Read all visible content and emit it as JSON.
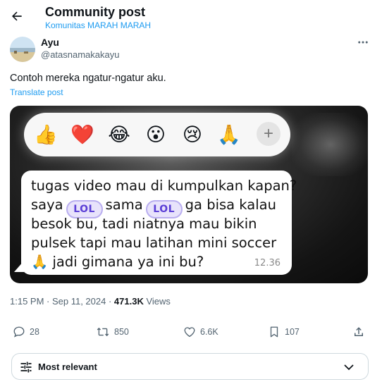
{
  "header": {
    "back_icon": "arrow-left-icon",
    "title": "Community post",
    "subtitle": "Komunitas MARAH MARAH"
  },
  "author": {
    "name": "Ayu",
    "handle": "@atasnamakakayu",
    "more_icon": "more-horizontal-icon"
  },
  "post": {
    "text": "Contoh mereka ngatur-ngatur aku.",
    "translate_label": "Translate post"
  },
  "media": {
    "reactions": [
      "👍",
      "❤️",
      "😂",
      "😮",
      "😢",
      "🙏"
    ],
    "reaction_plus": "+",
    "message": {
      "line1": "tugas video mau di kumpulkan kapan?",
      "line2_a": "saya",
      "line2_b": "sama",
      "line2_c": "ga bisa kalau",
      "lol_label": "LOL",
      "line3": "besok bu, tadi niatnya mau bikin",
      "line4": "pulsek tapi mau latihan mini soccer",
      "line5_emoji": "🙏",
      "line5": "jadi gimana ya ini bu?",
      "time": "12.36"
    }
  },
  "meta": {
    "timestamp": "1:15 PM · Sep 11, 2024 · ",
    "views_count": "471.3K",
    "views_label": " Views"
  },
  "actions": {
    "replies": "28",
    "reposts": "850",
    "likes": "6.6K",
    "bookmarks": "107"
  },
  "sort": {
    "label": "Most relevant"
  },
  "colors": {
    "accent": "#1d9bf0",
    "text_primary": "#0f1419",
    "text_secondary": "#536471"
  }
}
